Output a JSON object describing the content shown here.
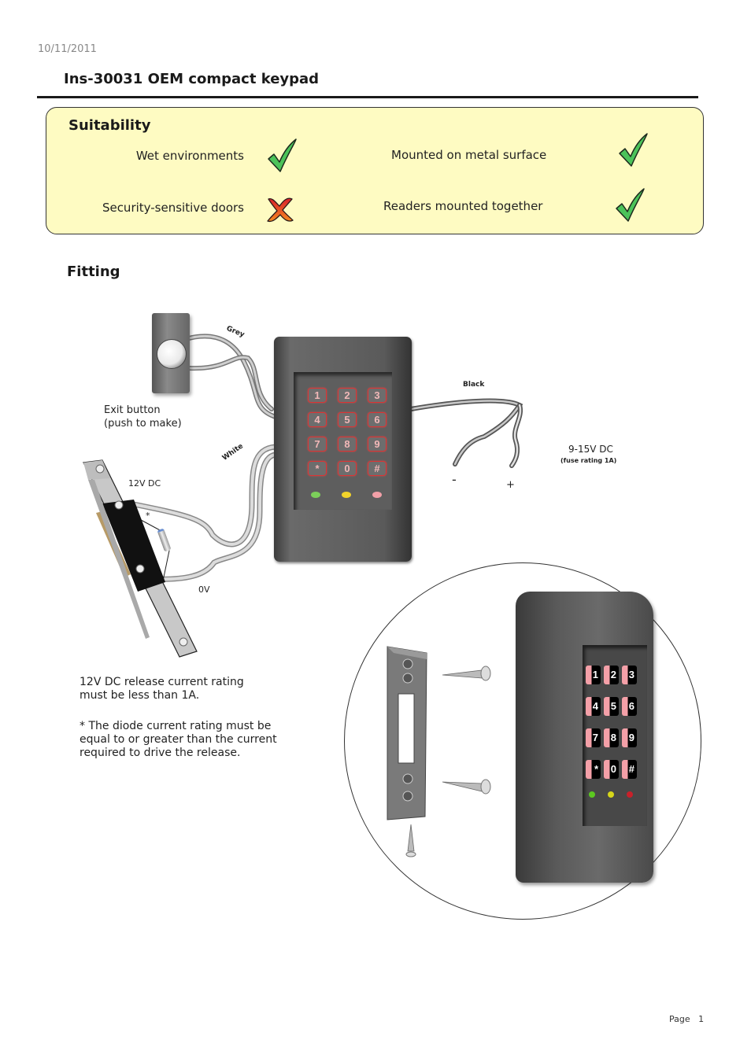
{
  "header": {
    "date": "10/11/2011",
    "title": "Ins-30031 OEM compact keypad"
  },
  "suitability": {
    "heading": "Suitability",
    "items": [
      {
        "label": "Wet environments",
        "status": "check-icon",
        "suitable": true
      },
      {
        "label": "Mounted on metal surface",
        "status": "check-icon",
        "suitable": true
      },
      {
        "label": "Security-sensitive doors",
        "status": "cross-icon",
        "suitable": false
      },
      {
        "label": "Readers mounted together",
        "status": "check-icon",
        "suitable": true
      }
    ],
    "colors": {
      "check": "#3cb54a",
      "cross": "#e23a2a",
      "box_bg": "#fefbc2"
    }
  },
  "fitting": {
    "heading": "Fitting",
    "exit_button_label": [
      "Exit button",
      "(push to make)"
    ],
    "wire_labels": {
      "grey": "Grey",
      "white": "White",
      "black": "Black"
    },
    "lock_labels": {
      "v12": "12V DC",
      "diode": "*",
      "v0": "0V"
    },
    "power": {
      "voltage": "9-15V DC",
      "fuse": "(fuse rating 1A)",
      "minus": "-",
      "plus": "+"
    },
    "keypad_keys": [
      "1",
      "2",
      "3",
      "4",
      "5",
      "6",
      "7",
      "8",
      "9",
      "*",
      "0",
      "#"
    ],
    "led_colors": [
      "#7ccf5a",
      "#f2d32a",
      "#f2a0a8"
    ],
    "notes": [
      [
        "12V DC release current rating",
        "must be less than 1A."
      ],
      [
        "* The diode current rating must be",
        "equal to or greater than the current",
        "required to drive the release."
      ]
    ]
  },
  "footer": {
    "page_label": "Page",
    "page_number": "1"
  }
}
